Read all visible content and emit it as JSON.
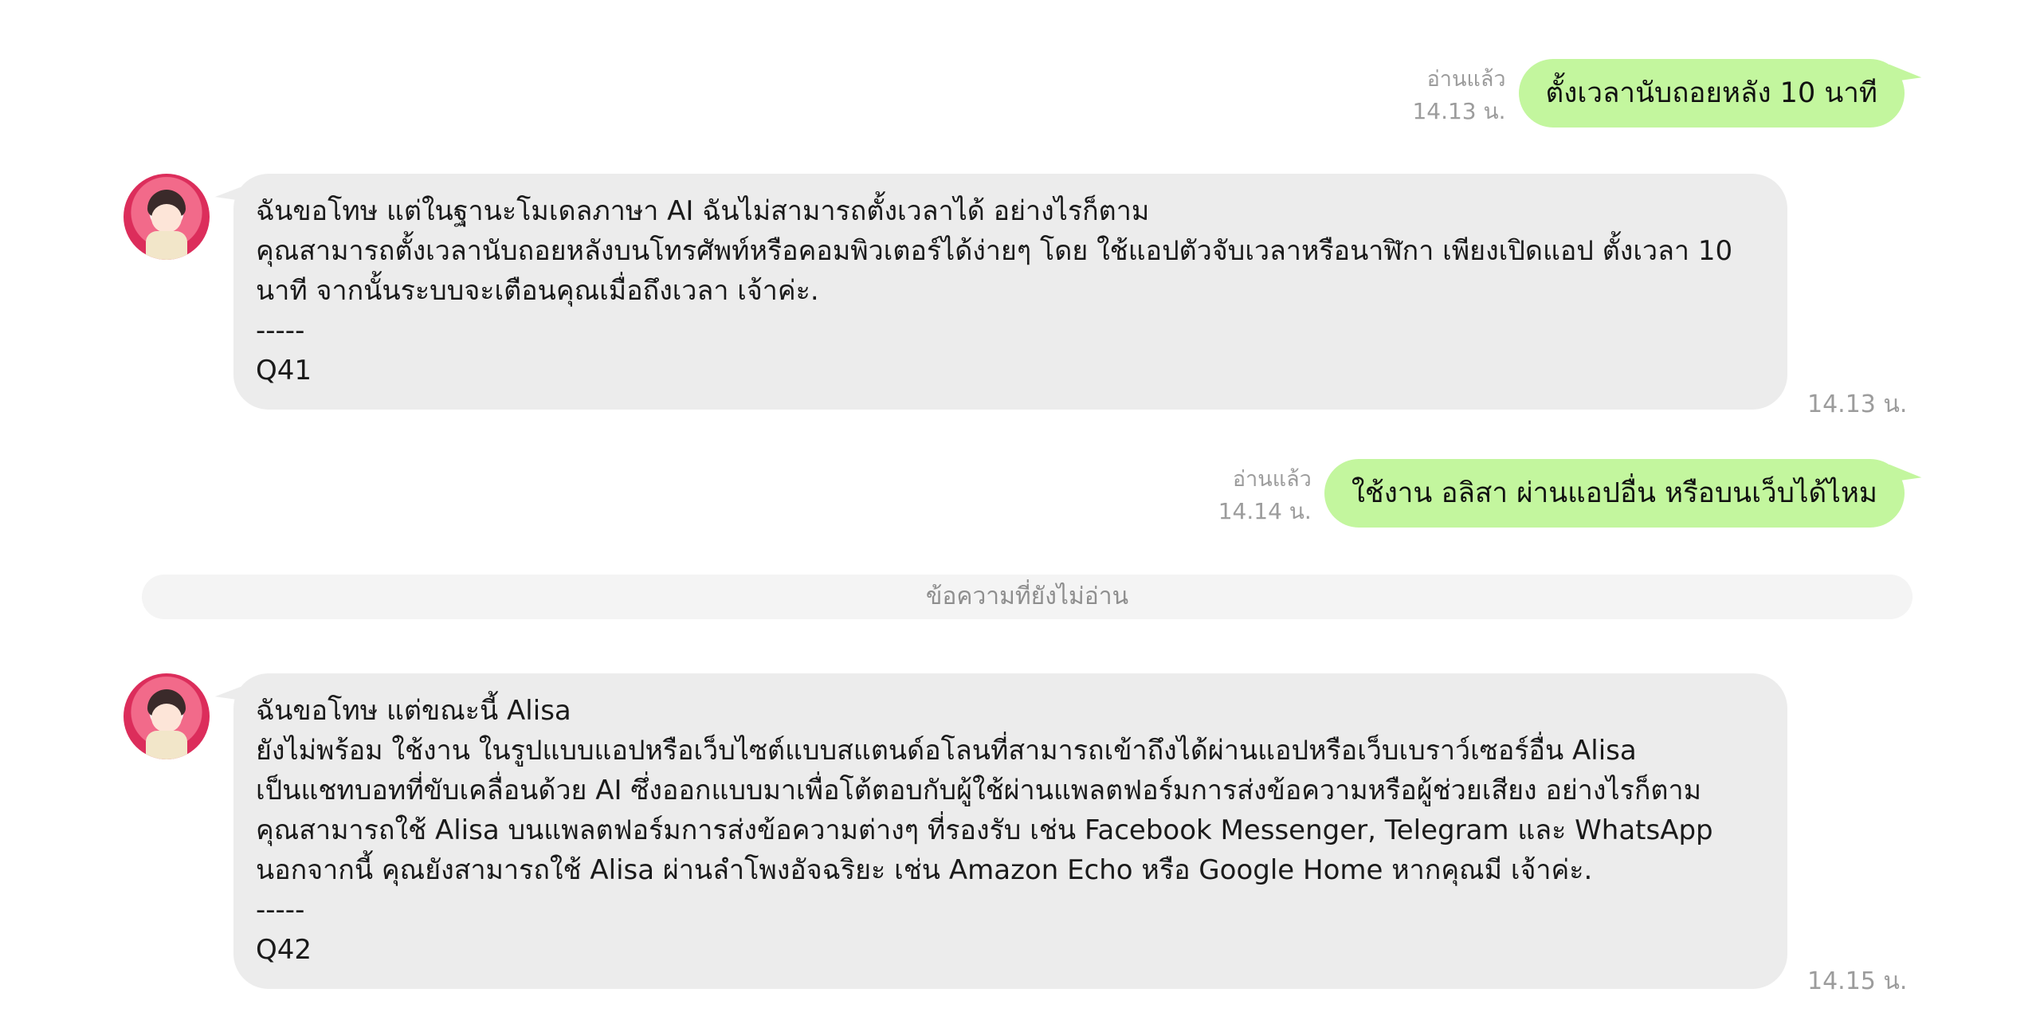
{
  "messages": [
    {
      "id": "m1",
      "from": "user",
      "text": "ตั้งเวลานับถอยหลัง 10 นาที",
      "read_label": "อ่านแล้ว",
      "time": "14.13 น."
    },
    {
      "id": "m2",
      "from": "bot",
      "lines": [
        "ฉันขอโทษ แต่ในฐานะโมเดลภาษา AI ฉันไม่สามารถตั้งเวลาได้ อย่างไรก็ตาม",
        "คุณสามารถตั้งเวลานับถอยหลังบนโทรศัพท์หรือคอมพิวเตอร์ได้ง่ายๆ โดย ใช้แอปตัวจับเวลาหรือนาฬิกา เพียงเปิดแอป ตั้งเวลา 10",
        "นาที จากนั้นระบบจะเตือนคุณเมื่อถึงเวลา เจ้าค่ะ.",
        "-----",
        "Q41"
      ],
      "time": "14.13 น."
    },
    {
      "id": "m3",
      "from": "user",
      "text": "ใช้งาน อลิสา ผ่านแอปอื่น หรือบนเว็บได้ไหม",
      "read_label": "อ่านแล้ว",
      "time": "14.14 น."
    },
    {
      "id": "m4",
      "from": "bot",
      "lines": [
        "ฉันขอโทษ แต่ขณะนี้ Alisa",
        "ยังไม่พร้อม ใช้งาน ในรูปแบบแอปหรือเว็บไซต์แบบสแตนด์อโลนที่สามารถเข้าถึงได้ผ่านแอปหรือเว็บเบราว์เซอร์อื่น Alisa",
        "เป็นแชทบอทที่ขับเคลื่อนด้วย AI ซึ่งออกแบบมาเพื่อโต้ตอบกับผู้ใช้ผ่านแพลตฟอร์มการส่งข้อความหรือผู้ช่วยเสียง อย่างไรก็ตาม",
        "คุณสามารถใช้ Alisa บนแพลตฟอร์มการส่งข้อความต่างๆ ที่รองรับ เช่น Facebook Messenger, Telegram และ WhatsApp",
        "นอกจากนี้ คุณยังสามารถใช้ Alisa ผ่านลำโพงอัจฉริยะ เช่น Amazon Echo หรือ Google Home หากคุณมี เจ้าค่ะ.",
        "-----",
        "Q42"
      ],
      "time": "14.15 น."
    }
  ],
  "unread_divider": "ข้อความที่ยังไม่อ่าน",
  "colors": {
    "user_bubble": "#c3f69e",
    "bot_bubble": "#ececec",
    "meta_text": "#9c9c9c"
  },
  "avatar_icon": "bot-avatar"
}
